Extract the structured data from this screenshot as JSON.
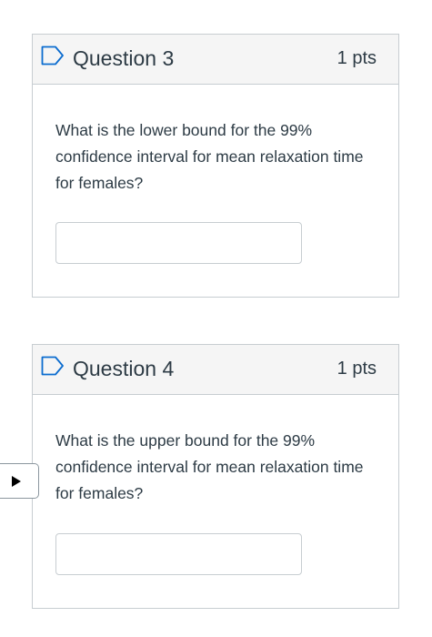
{
  "questions": [
    {
      "title": "Question 3",
      "points": "1 pts",
      "text": "What is the lower bound for the 99% confidence interval for mean relaxation time for females?",
      "answer_value": ""
    },
    {
      "title": "Question 4",
      "points": "1 pts",
      "text": "What is the upper bound for the 99% confidence interval for mean relaxation time for females?",
      "answer_value": ""
    }
  ],
  "icons": {
    "flag": "flag-outline-icon",
    "nav_toggle": "play-triangle-icon"
  },
  "colors": {
    "border": "#c7cdd1",
    "header_bg": "#f5f5f5",
    "flag_stroke": "#0b6ccf",
    "text": "#2d3b45"
  }
}
